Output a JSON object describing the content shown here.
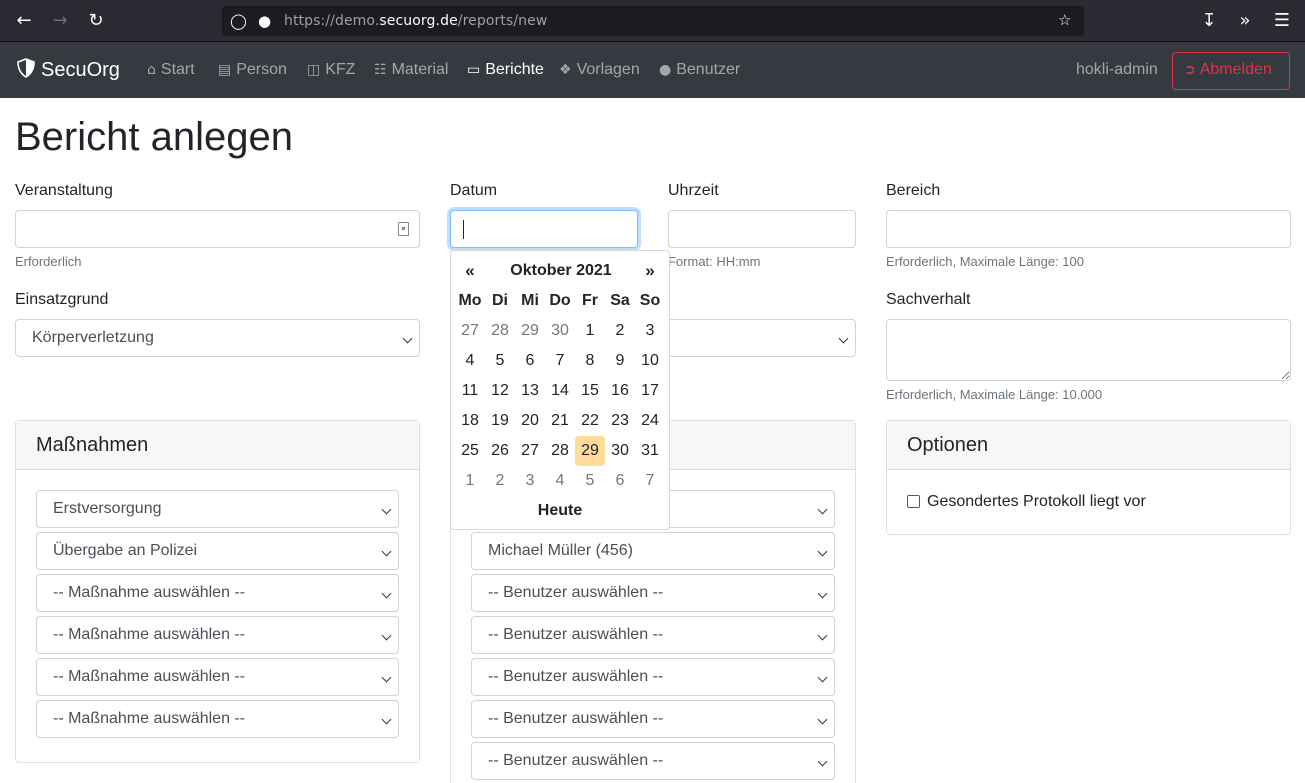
{
  "browser": {
    "url_prefix": "https://demo.",
    "url_domain": "secuorg.de",
    "url_path": "/reports/new"
  },
  "navbar": {
    "brand": "SecuOrg",
    "items": [
      {
        "label": "Start",
        "icon": "home-icon"
      },
      {
        "label": "Person",
        "icon": "id-card-icon"
      },
      {
        "label": "KFZ",
        "icon": "car-icon"
      },
      {
        "label": "Material",
        "icon": "barcode-icon"
      },
      {
        "label": "Berichte",
        "icon": "file-icon",
        "active": true
      },
      {
        "label": "Vorlagen",
        "icon": "cubes-icon"
      },
      {
        "label": "Benutzer",
        "icon": "users-icon"
      }
    ],
    "user": "hokli-admin",
    "logout": "Abmelden"
  },
  "page": {
    "title": "Bericht anlegen"
  },
  "form": {
    "veranstaltung": {
      "label": "Veranstaltung",
      "value": "",
      "help": "Erforderlich"
    },
    "datum": {
      "label": "Datum",
      "value": ""
    },
    "uhrzeit": {
      "label": "Uhrzeit",
      "value": "",
      "help": "Format: HH:mm"
    },
    "bereich": {
      "label": "Bereich",
      "value": "",
      "help": "Erforderlich, Maximale Länge: 100"
    },
    "einsatzgrund": {
      "label": "Einsatzgrund",
      "value": "Körperverletzung"
    },
    "sachverhalt": {
      "label": "Sachverhalt",
      "value": "",
      "help": "Erforderlich, Maximale Länge: 10.000"
    }
  },
  "massnahmen": {
    "title": "Maßnahmen",
    "selects": [
      "Erstversorgung",
      "Übergabe an Polizei",
      "-- Maßnahme auswählen --",
      "-- Maßnahme auswählen --",
      "-- Maßnahme auswählen --",
      "-- Maßnahme auswählen --"
    ]
  },
  "benutzer": {
    "selects": [
      "Michael Müller (456)",
      "-- Benutzer auswählen --",
      "-- Benutzer auswählen --",
      "-- Benutzer auswählen --",
      "-- Benutzer auswählen --",
      "-- Benutzer auswählen --"
    ]
  },
  "optionen": {
    "title": "Optionen",
    "checkbox_label": "Gesondertes Protokoll liegt vor",
    "checked": false
  },
  "datepicker": {
    "prev": "«",
    "next": "»",
    "month": "Oktober 2021",
    "weekdays": [
      "Mo",
      "Di",
      "Mi",
      "Do",
      "Fr",
      "Sa",
      "So"
    ],
    "weeks": [
      [
        "27",
        "28",
        "29",
        "30",
        "1",
        "2",
        "3"
      ],
      [
        "4",
        "5",
        "6",
        "7",
        "8",
        "9",
        "10"
      ],
      [
        "11",
        "12",
        "13",
        "14",
        "15",
        "16",
        "17"
      ],
      [
        "18",
        "19",
        "20",
        "21",
        "22",
        "23",
        "24"
      ],
      [
        "25",
        "26",
        "27",
        "28",
        "29",
        "30",
        "31"
      ],
      [
        "1",
        "2",
        "3",
        "4",
        "5",
        "6",
        "7"
      ]
    ],
    "today_label": "Heute",
    "highlight": "29"
  }
}
